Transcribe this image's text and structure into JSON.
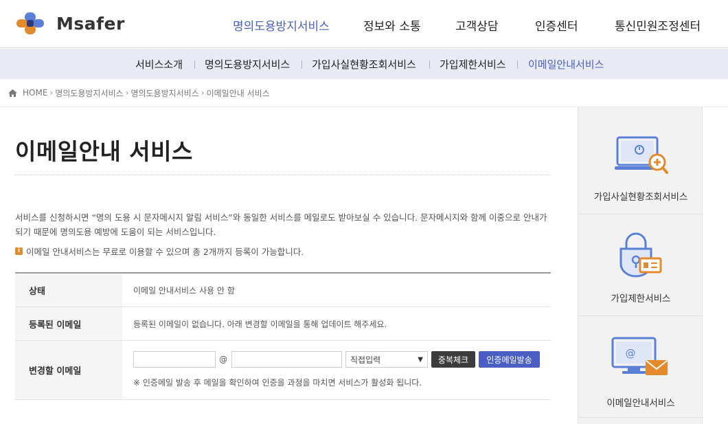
{
  "header": {
    "logo_text": "Msafer",
    "nav": [
      {
        "label": "명의도용방지서비스",
        "active": true
      },
      {
        "label": "정보와 소통",
        "active": false
      },
      {
        "label": "고객상담",
        "active": false
      },
      {
        "label": "인증센터",
        "active": false
      },
      {
        "label": "통신민원조정센터",
        "active": false
      }
    ]
  },
  "subnav": {
    "items": [
      {
        "label": "서비스소개",
        "active": false
      },
      {
        "label": "명의도용방지서비스",
        "active": false
      },
      {
        "label": "가입사실현황조회서비스",
        "active": false
      },
      {
        "label": "가입제한서비스",
        "active": false
      },
      {
        "label": "이메일안내서비스",
        "active": true
      }
    ]
  },
  "breadcrumb": {
    "home": "HOME",
    "items": [
      "명의도용방지서비스",
      "명의도용방지서비스",
      "이메일안내 서비스"
    ]
  },
  "main": {
    "title": "이메일안내 서비스",
    "description": "서비스를 신청하시면 “명의 도용 시 문자메시지 알림 서비스”와 동일한 서비스를 메일로도 받아보실 수 있습니다. 문자메시지와 함께 이중으로 안내가 되기 때문에 명의도용 예방에 도움이 되는 서비스입니다.",
    "notice": "이메일 안내서비스는 무료로 이용할 수 있으며 총 2개까지 등록이 가능합니다.",
    "table": {
      "status_label": "상태",
      "status_value": "이메일 안내서비스 사용 안 함",
      "registered_label": "등록된 이메일",
      "registered_value": "등록된 이메일이 없습니다. 아래 변경할 이메일을 통해 업데이트 해주세요.",
      "change_label": "변경할 이메일",
      "email_local_value": "",
      "at_sign": "@",
      "email_domain_value": "",
      "domain_select": "직접입력",
      "dup_check_button": "중복체크",
      "send_button": "인증메일발송",
      "note": "※ 인증메일 발송 후 메일을 확인하여 인증을 과정을 마치면 서비스가 활성화 됩니다."
    }
  },
  "quick_menu": {
    "items": [
      {
        "label": "가입사실현황조회서비스",
        "icon": "laptop-search-icon"
      },
      {
        "label": "가입제한서비스",
        "icon": "lock-id-icon"
      },
      {
        "label": "이메일안내서비스",
        "icon": "monitor-mail-icon"
      }
    ]
  },
  "colors": {
    "accent": "#4a5ec3",
    "icon_blue": "#5b7fd6",
    "icon_orange": "#e58a2c",
    "subnav_bg": "#e8ebf3"
  }
}
